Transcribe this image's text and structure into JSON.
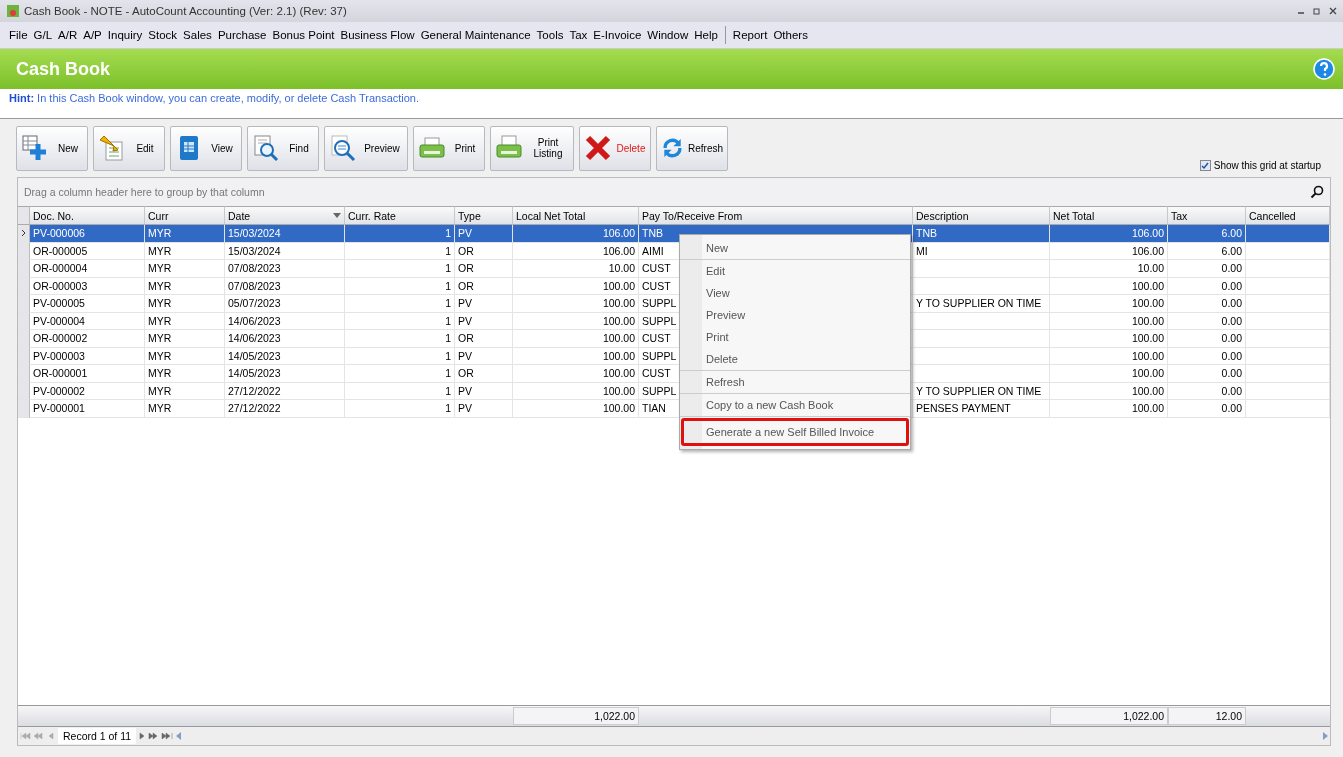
{
  "window": {
    "title": "Cash Book - NOTE - AutoCount Accounting (Ver: 2.1) (Rev: 37)"
  },
  "menu_bar": {
    "items": [
      "File",
      "G/L",
      "A/R",
      "A/P",
      "Inquiry",
      "Stock",
      "Sales",
      "Purchase",
      "Bonus Point",
      "Business Flow",
      "General Maintenance",
      "Tools",
      "Tax",
      "E-Invoice",
      "Window",
      "Help"
    ],
    "extra_items": [
      "Report",
      "Others"
    ]
  },
  "header": {
    "title": "Cash Book"
  },
  "hint": "**Hint:** In this Cash Book window, you can create, modify, or delete Cash Transaction.",
  "toolbar": [
    {
      "label": "New",
      "danger": false
    },
    {
      "label": "Edit",
      "danger": false
    },
    {
      "label": "View",
      "danger": false
    },
    {
      "label": "Find",
      "danger": false
    },
    {
      "label": "Preview",
      "danger": false
    },
    {
      "label": "Print",
      "danger": false
    },
    {
      "label": "Print Listing",
      "danger": false
    },
    {
      "label": "Delete",
      "danger": true
    },
    {
      "label": "Refresh",
      "danger": false
    }
  ],
  "startup_option": {
    "label": "Show this grid at startup",
    "checked": true
  },
  "grid": {
    "group_panel": "Drag a column header here to group by that column",
    "columns": [
      {
        "label": "Doc. No."
      },
      {
        "label": "Curr"
      },
      {
        "label": "Date",
        "sorted_descending": true
      },
      {
        "label": "Curr. Rate"
      },
      {
        "label": "Type"
      },
      {
        "label": "Local Net Total"
      },
      {
        "label": "Pay To/Receive From"
      },
      {
        "label": "Description"
      },
      {
        "label": "Net Total"
      },
      {
        "label": "Tax"
      },
      {
        "label": "Cancelled"
      }
    ],
    "rows": [
      {
        "selected": true,
        "doc_no": "PV-000006",
        "curr": "MYR",
        "date": "15/03/2024",
        "curr_rate": "1",
        "type": "PV",
        "local_net_total": "106.00",
        "pay_to": "TNB",
        "description": "TNB",
        "net_total": "106.00",
        "tax": "6.00"
      },
      {
        "selected": false,
        "doc_no": "OR-000005",
        "curr": "MYR",
        "date": "15/03/2024",
        "curr_rate": "1",
        "type": "OR",
        "local_net_total": "106.00",
        "pay_to": "AIMI",
        "description": "MI",
        "net_total": "106.00",
        "tax": "6.00"
      },
      {
        "selected": false,
        "doc_no": "OR-000004",
        "curr": "MYR",
        "date": "07/08/2023",
        "curr_rate": "1",
        "type": "OR",
        "local_net_total": "10.00",
        "pay_to": "CUST",
        "net_total": "10.00",
        "tax": "0.00"
      },
      {
        "selected": false,
        "doc_no": "OR-000003",
        "curr": "MYR",
        "date": "07/08/2023",
        "curr_rate": "1",
        "type": "OR",
        "local_net_total": "100.00",
        "pay_to": "CUST",
        "net_total": "100.00",
        "tax": "0.00"
      },
      {
        "selected": false,
        "doc_no": "PV-000005",
        "curr": "MYR",
        "date": "05/07/2023",
        "curr_rate": "1",
        "type": "PV",
        "local_net_total": "100.00",
        "pay_to": "SUPPL",
        "description": "Y TO SUPPLIER ON TIME",
        "net_total": "100.00",
        "tax": "0.00"
      },
      {
        "selected": false,
        "doc_no": "PV-000004",
        "curr": "MYR",
        "date": "14/06/2023",
        "curr_rate": "1",
        "type": "PV",
        "local_net_total": "100.00",
        "pay_to": "SUPPL",
        "net_total": "100.00",
        "tax": "0.00"
      },
      {
        "selected": false,
        "doc_no": "OR-000002",
        "curr": "MYR",
        "date": "14/06/2023",
        "curr_rate": "1",
        "type": "OR",
        "local_net_total": "100.00",
        "pay_to": "CUST",
        "net_total": "100.00",
        "tax": "0.00"
      },
      {
        "selected": false,
        "doc_no": "PV-000003",
        "curr": "MYR",
        "date": "14/05/2023",
        "curr_rate": "1",
        "type": "PV",
        "local_net_total": "100.00",
        "pay_to": "SUPPL",
        "net_total": "100.00",
        "tax": "0.00"
      },
      {
        "selected": false,
        "doc_no": "OR-000001",
        "curr": "MYR",
        "date": "14/05/2023",
        "curr_rate": "1",
        "type": "OR",
        "local_net_total": "100.00",
        "pay_to": "CUST",
        "net_total": "100.00",
        "tax": "0.00"
      },
      {
        "selected": false,
        "doc_no": "PV-000002",
        "curr": "MYR",
        "date": "27/12/2022",
        "curr_rate": "1",
        "type": "PV",
        "local_net_total": "100.00",
        "pay_to": "SUPPL",
        "description": "Y TO SUPPLIER ON TIME",
        "net_total": "100.00",
        "tax": "0.00"
      },
      {
        "selected": false,
        "doc_no": "PV-000001",
        "curr": "MYR",
        "date": "27/12/2022",
        "curr_rate": "1",
        "type": "PV",
        "local_net_total": "100.00",
        "pay_to": "TIAN",
        "description": "PENSES PAYMENT",
        "net_total": "100.00",
        "tax": "0.00"
      }
    ],
    "totals": {
      "local_net_total": "1,022.00",
      "net_total": "1,022.00",
      "tax": "12.00"
    },
    "navigator": "Record 1 of 11"
  },
  "context_menu": [
    [
      {
        "label": "New",
        "highlighted": false
      }
    ],
    [
      {
        "label": "Edit",
        "highlighted": false
      },
      {
        "label": "View",
        "highlighted": false
      },
      {
        "label": "Preview",
        "highlighted": false
      },
      {
        "label": "Print",
        "highlighted": false
      },
      {
        "label": "Delete",
        "highlighted": false
      }
    ],
    [
      {
        "label": "Refresh",
        "highlighted": false
      }
    ],
    [
      {
        "label": "Copy to a new Cash Book",
        "highlighted": false
      }
    ],
    [
      {
        "label": "Generate a new Self Billed Invoice",
        "highlighted": true
      }
    ]
  ]
}
